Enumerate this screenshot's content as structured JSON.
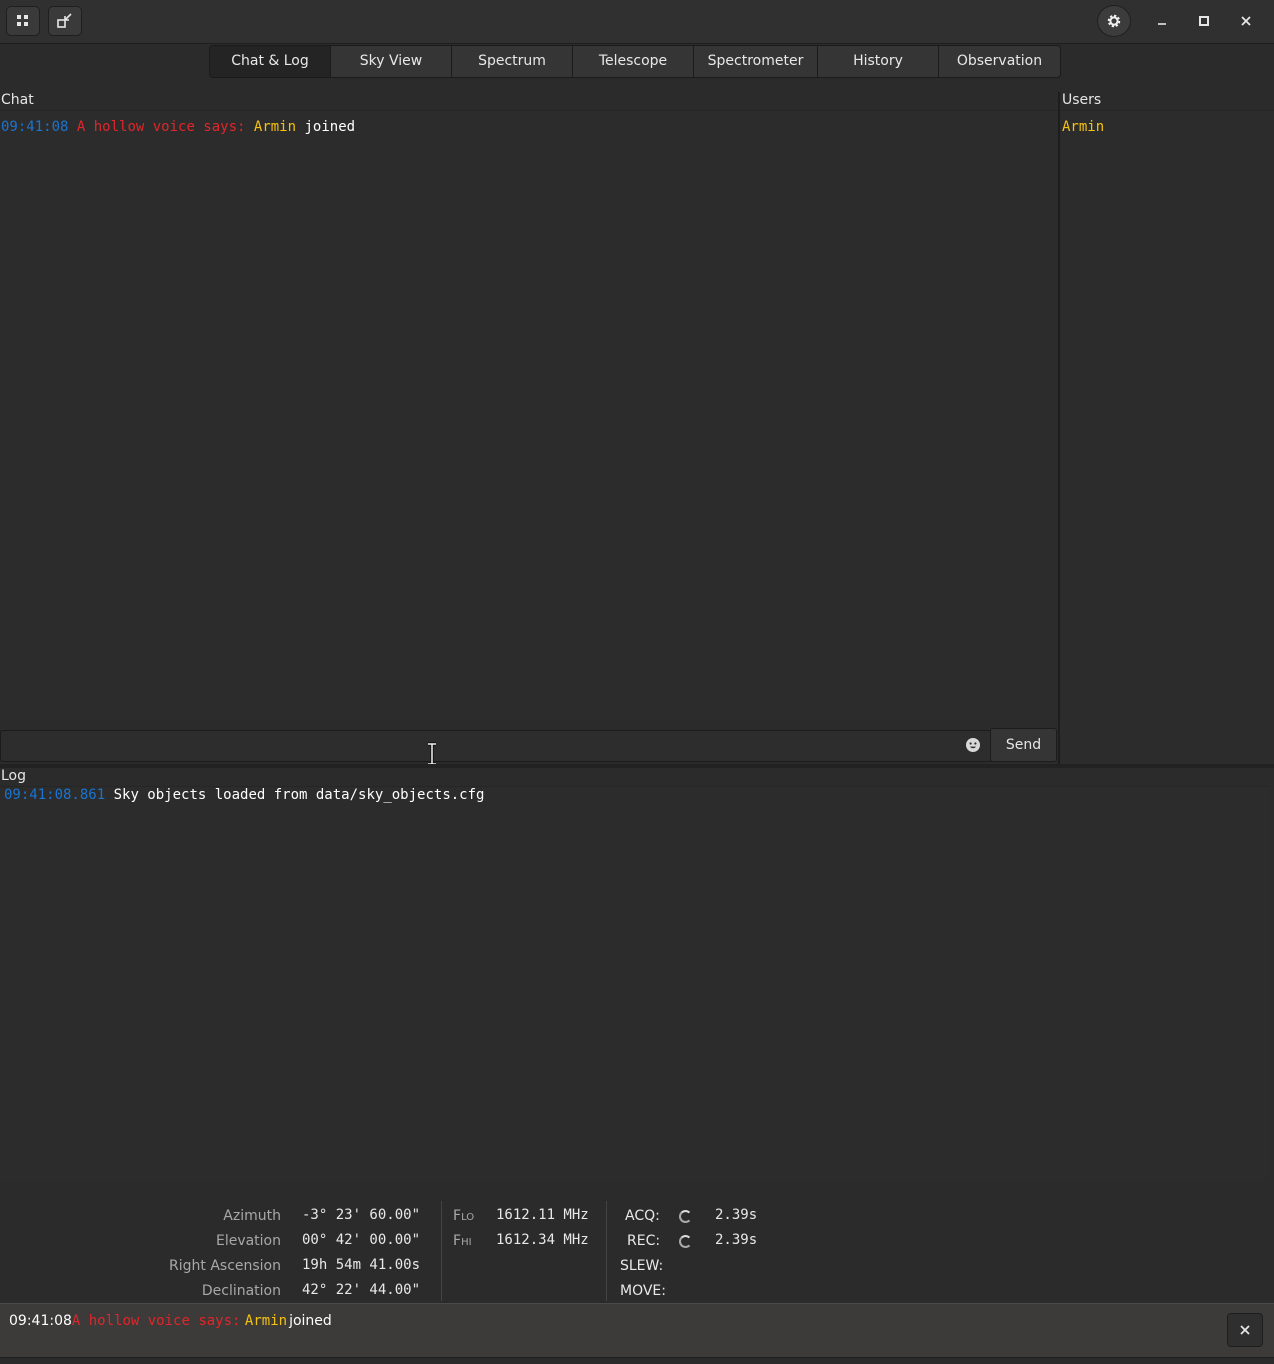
{
  "header": {
    "left_icons": [
      "grid-icon",
      "restore-icon"
    ],
    "right_icons": [
      "gear-icon",
      "minimize-icon",
      "maximize-icon",
      "close-icon"
    ]
  },
  "tabs": [
    {
      "label": "Chat & Log",
      "active": true
    },
    {
      "label": "Sky View",
      "active": false
    },
    {
      "label": "Spectrum",
      "active": false
    },
    {
      "label": "Telescope",
      "active": false
    },
    {
      "label": "Spectrometer",
      "active": false
    },
    {
      "label": "History",
      "active": false
    },
    {
      "label": "Observation",
      "active": false
    }
  ],
  "chat": {
    "label": "Chat",
    "messages": [
      {
        "time": "09:41:08",
        "speaker": "A hollow voice says:",
        "user": "Armin",
        "text": "joined"
      }
    ],
    "input_value": "",
    "emoji_icon": "emoji-icon",
    "send_label": "Send"
  },
  "users": {
    "label": "Users",
    "list": [
      "Armin"
    ]
  },
  "log": {
    "label": "Log",
    "entries": [
      {
        "time": "09:41:08.861",
        "text": "Sky objects loaded from data/sky_objects.cfg"
      }
    ]
  },
  "status": {
    "position": {
      "azimuth_label": "Azimuth",
      "azimuth": "-3° 23' 60.00\"",
      "elevation_label": "Elevation",
      "elevation": "00° 42' 00.00\"",
      "ra_label": "Right Ascension",
      "ra": "19h 54m 41.00s",
      "dec_label": "Declination",
      "dec": "42° 22' 44.00\""
    },
    "frequency": {
      "flo_label_main": "F",
      "flo_label_sub": "LO",
      "flo": "1612.11 MHz",
      "fhi_label_main": "F",
      "fhi_label_sub": "HI",
      "fhi": "1612.34 MHz"
    },
    "flags": {
      "acq_label": "ACQ:",
      "acq_time": "2.39s",
      "rec_label": "REC:",
      "rec_time": "2.39s",
      "slew_label": "SLEW:",
      "move_label": "MOVE:"
    }
  },
  "notification": {
    "time": "09:41:08",
    "speaker": "A hollow voice says:",
    "user": "Armin",
    "text": "joined",
    "close_icon": "close-icon"
  },
  "colors": {
    "background": "#2b2b2b",
    "speaker": "#e0262a",
    "user": "#f5c211",
    "timestamp": "#1a74d0"
  }
}
